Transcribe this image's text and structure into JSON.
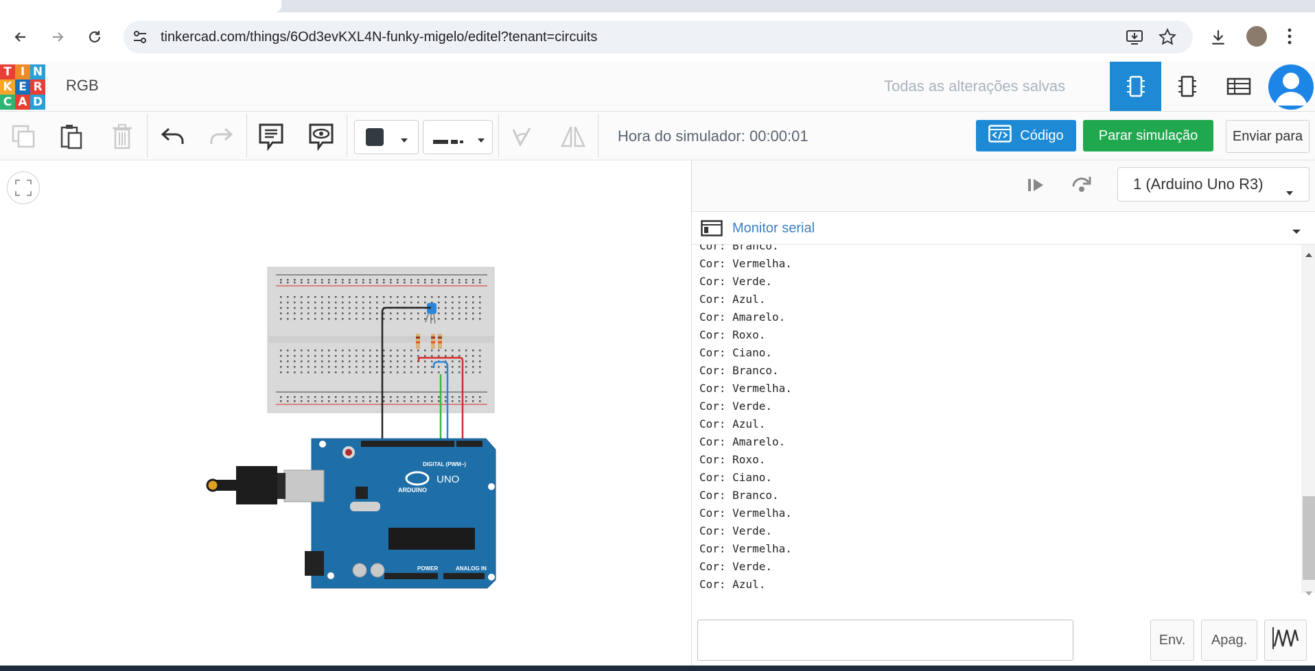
{
  "browser": {
    "url": "tinkercad.com/things/6Od3evKXL4N-funky-migelo/editel?tenant=circuits"
  },
  "logo": {
    "letters": [
      "T",
      "I",
      "N",
      "K",
      "E",
      "R",
      "C",
      "A",
      "D"
    ]
  },
  "header": {
    "project_name": "RGB",
    "save_status": "Todas as alterações salvas"
  },
  "toolbar": {
    "sim_time": "Hora do simulador: 00:00:01",
    "code_label": "Código",
    "stop_label": "Parar simulação",
    "send_label": "Enviar para"
  },
  "panel": {
    "device": "1 (Arduino Uno R3)",
    "serial_title": "Monitor serial",
    "lines": [
      "Cor: Branco.",
      "Cor: Vermelha.",
      "Cor: Verde.",
      "Cor: Azul.",
      "Cor: Amarelo.",
      "Cor: Roxo.",
      "Cor: Ciano.",
      "Cor: Branco.",
      "Cor: Vermelha.",
      "Cor: Verde.",
      "Cor: Azul.",
      "Cor: Amarelo.",
      "Cor: Roxo.",
      "Cor: Ciano.",
      "Cor: Branco.",
      "Cor: Vermelha.",
      "Cor: Verde.",
      "Cor: Vermelha.",
      "Cor: Verde.",
      "Cor: Azul."
    ],
    "send_btn": "Env.",
    "clear_btn": "Apag."
  },
  "board": {
    "brand": "ARDUINO",
    "model": "UNO",
    "digital_label": "DIGITAL (PWM~)",
    "power_label": "POWER",
    "analog_label": "ANALOG IN"
  },
  "colors": {
    "accent_blue": "#1e8ad6",
    "stop_green": "#20a84f",
    "board_blue": "#1e6ea8",
    "wire_red": "#d52a2a",
    "wire_green": "#3db541",
    "wire_blue": "#2b86d9",
    "wire_black": "#222222"
  }
}
